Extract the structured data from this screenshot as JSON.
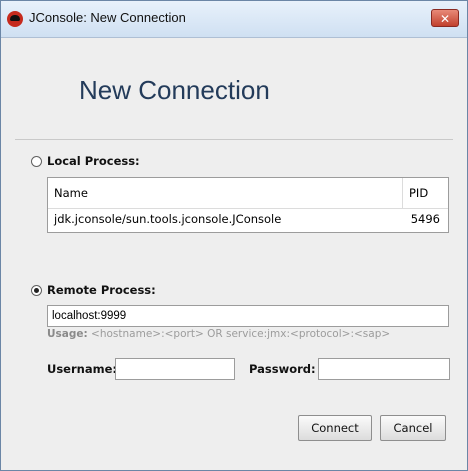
{
  "window": {
    "title": "JConsole: New Connection",
    "close_glyph": "✕"
  },
  "header": {
    "title": "New Connection"
  },
  "local": {
    "label": "Local Process:",
    "selected": false,
    "columns": {
      "name": "Name",
      "pid": "PID"
    },
    "rows": [
      {
        "name": "jdk.jconsole/sun.tools.jconsole.JConsole",
        "pid": "5496"
      }
    ]
  },
  "remote": {
    "label": "Remote Process:",
    "selected": true,
    "address": "localhost:9999",
    "usage_label": "Usage:",
    "usage_text": "<hostname>:<port> OR service:jmx:<protocol>:<sap>",
    "username_label": "Username:",
    "username_value": "",
    "password_label": "Password:",
    "password_value": ""
  },
  "buttons": {
    "connect": "Connect",
    "cancel": "Cancel"
  }
}
